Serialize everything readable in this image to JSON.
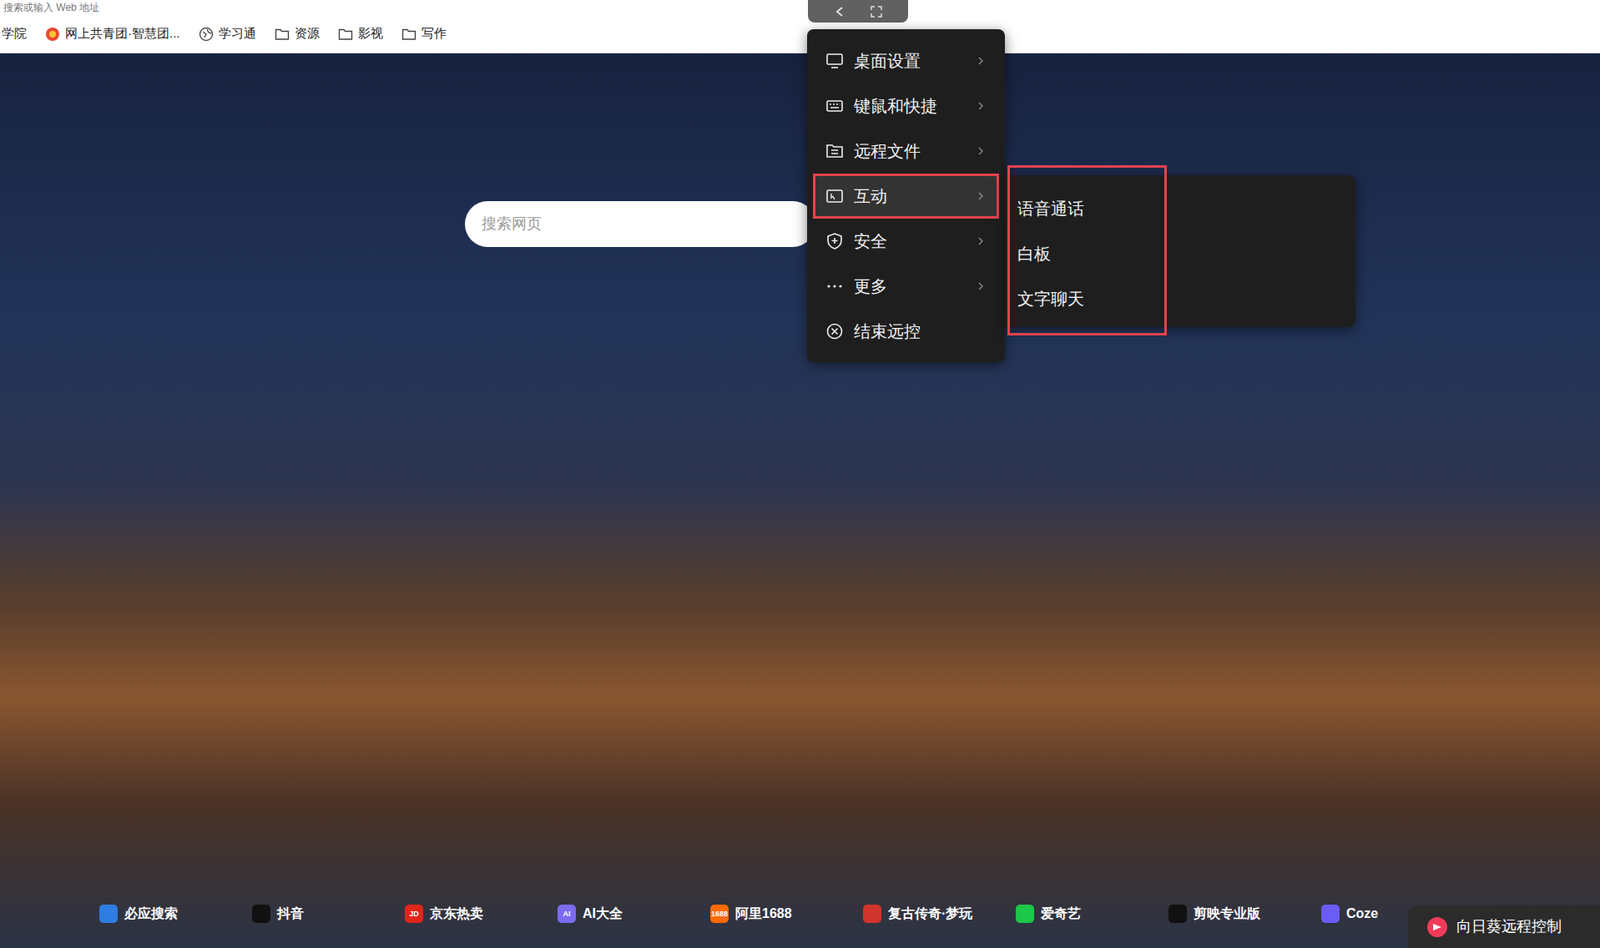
{
  "browser": {
    "address_placeholder": "搜索或输入 Web 地址"
  },
  "bookmarks": [
    {
      "label": "学院",
      "kind": "text"
    },
    {
      "label": "网上共青团·智慧团...",
      "kind": "site"
    },
    {
      "label": "学习通",
      "kind": "globe"
    },
    {
      "label": "资源",
      "kind": "folder"
    },
    {
      "label": "影视",
      "kind": "folder"
    },
    {
      "label": "写作",
      "kind": "folder"
    }
  ],
  "search": {
    "placeholder": "搜索网页"
  },
  "remote_menu": {
    "items": [
      {
        "label": "桌面设置",
        "has_submenu": true,
        "selected": false
      },
      {
        "label": "键鼠和快捷",
        "has_submenu": true,
        "selected": false
      },
      {
        "label": "远程文件",
        "has_submenu": true,
        "selected": false
      },
      {
        "label": "互动",
        "has_submenu": true,
        "selected": true
      },
      {
        "label": "安全",
        "has_submenu": true,
        "selected": false
      },
      {
        "label": "更多",
        "has_submenu": true,
        "selected": false
      },
      {
        "label": "结束远控",
        "has_submenu": false,
        "selected": false
      }
    ]
  },
  "submenu": {
    "items": [
      {
        "label": "语音通话"
      },
      {
        "label": "白板"
      },
      {
        "label": "文字聊天"
      }
    ]
  },
  "quick_links": [
    {
      "label": "必应搜索",
      "icon_text": "",
      "color": "#2f7de1"
    },
    {
      "label": "抖音",
      "icon_text": "",
      "color": "#111111"
    },
    {
      "label": "京东热卖",
      "icon_text": "JD",
      "color": "#e1251b"
    },
    {
      "label": "AI大全",
      "icon_text": "AI",
      "color": "#7b6cf0"
    },
    {
      "label": "阿里1688",
      "icon_text": "1688",
      "color": "#ff6a00"
    },
    {
      "label": "复古传奇·梦玩",
      "icon_text": "",
      "color": "#d0342c"
    },
    {
      "label": "爱奇艺",
      "icon_text": "",
      "color": "#1cc749"
    },
    {
      "label": "剪映专业版",
      "icon_text": "",
      "color": "#111111"
    },
    {
      "label": "Coze",
      "icon_text": "",
      "color": "#6b5cf6"
    }
  ],
  "badge": {
    "label": "向日葵远程控制"
  }
}
